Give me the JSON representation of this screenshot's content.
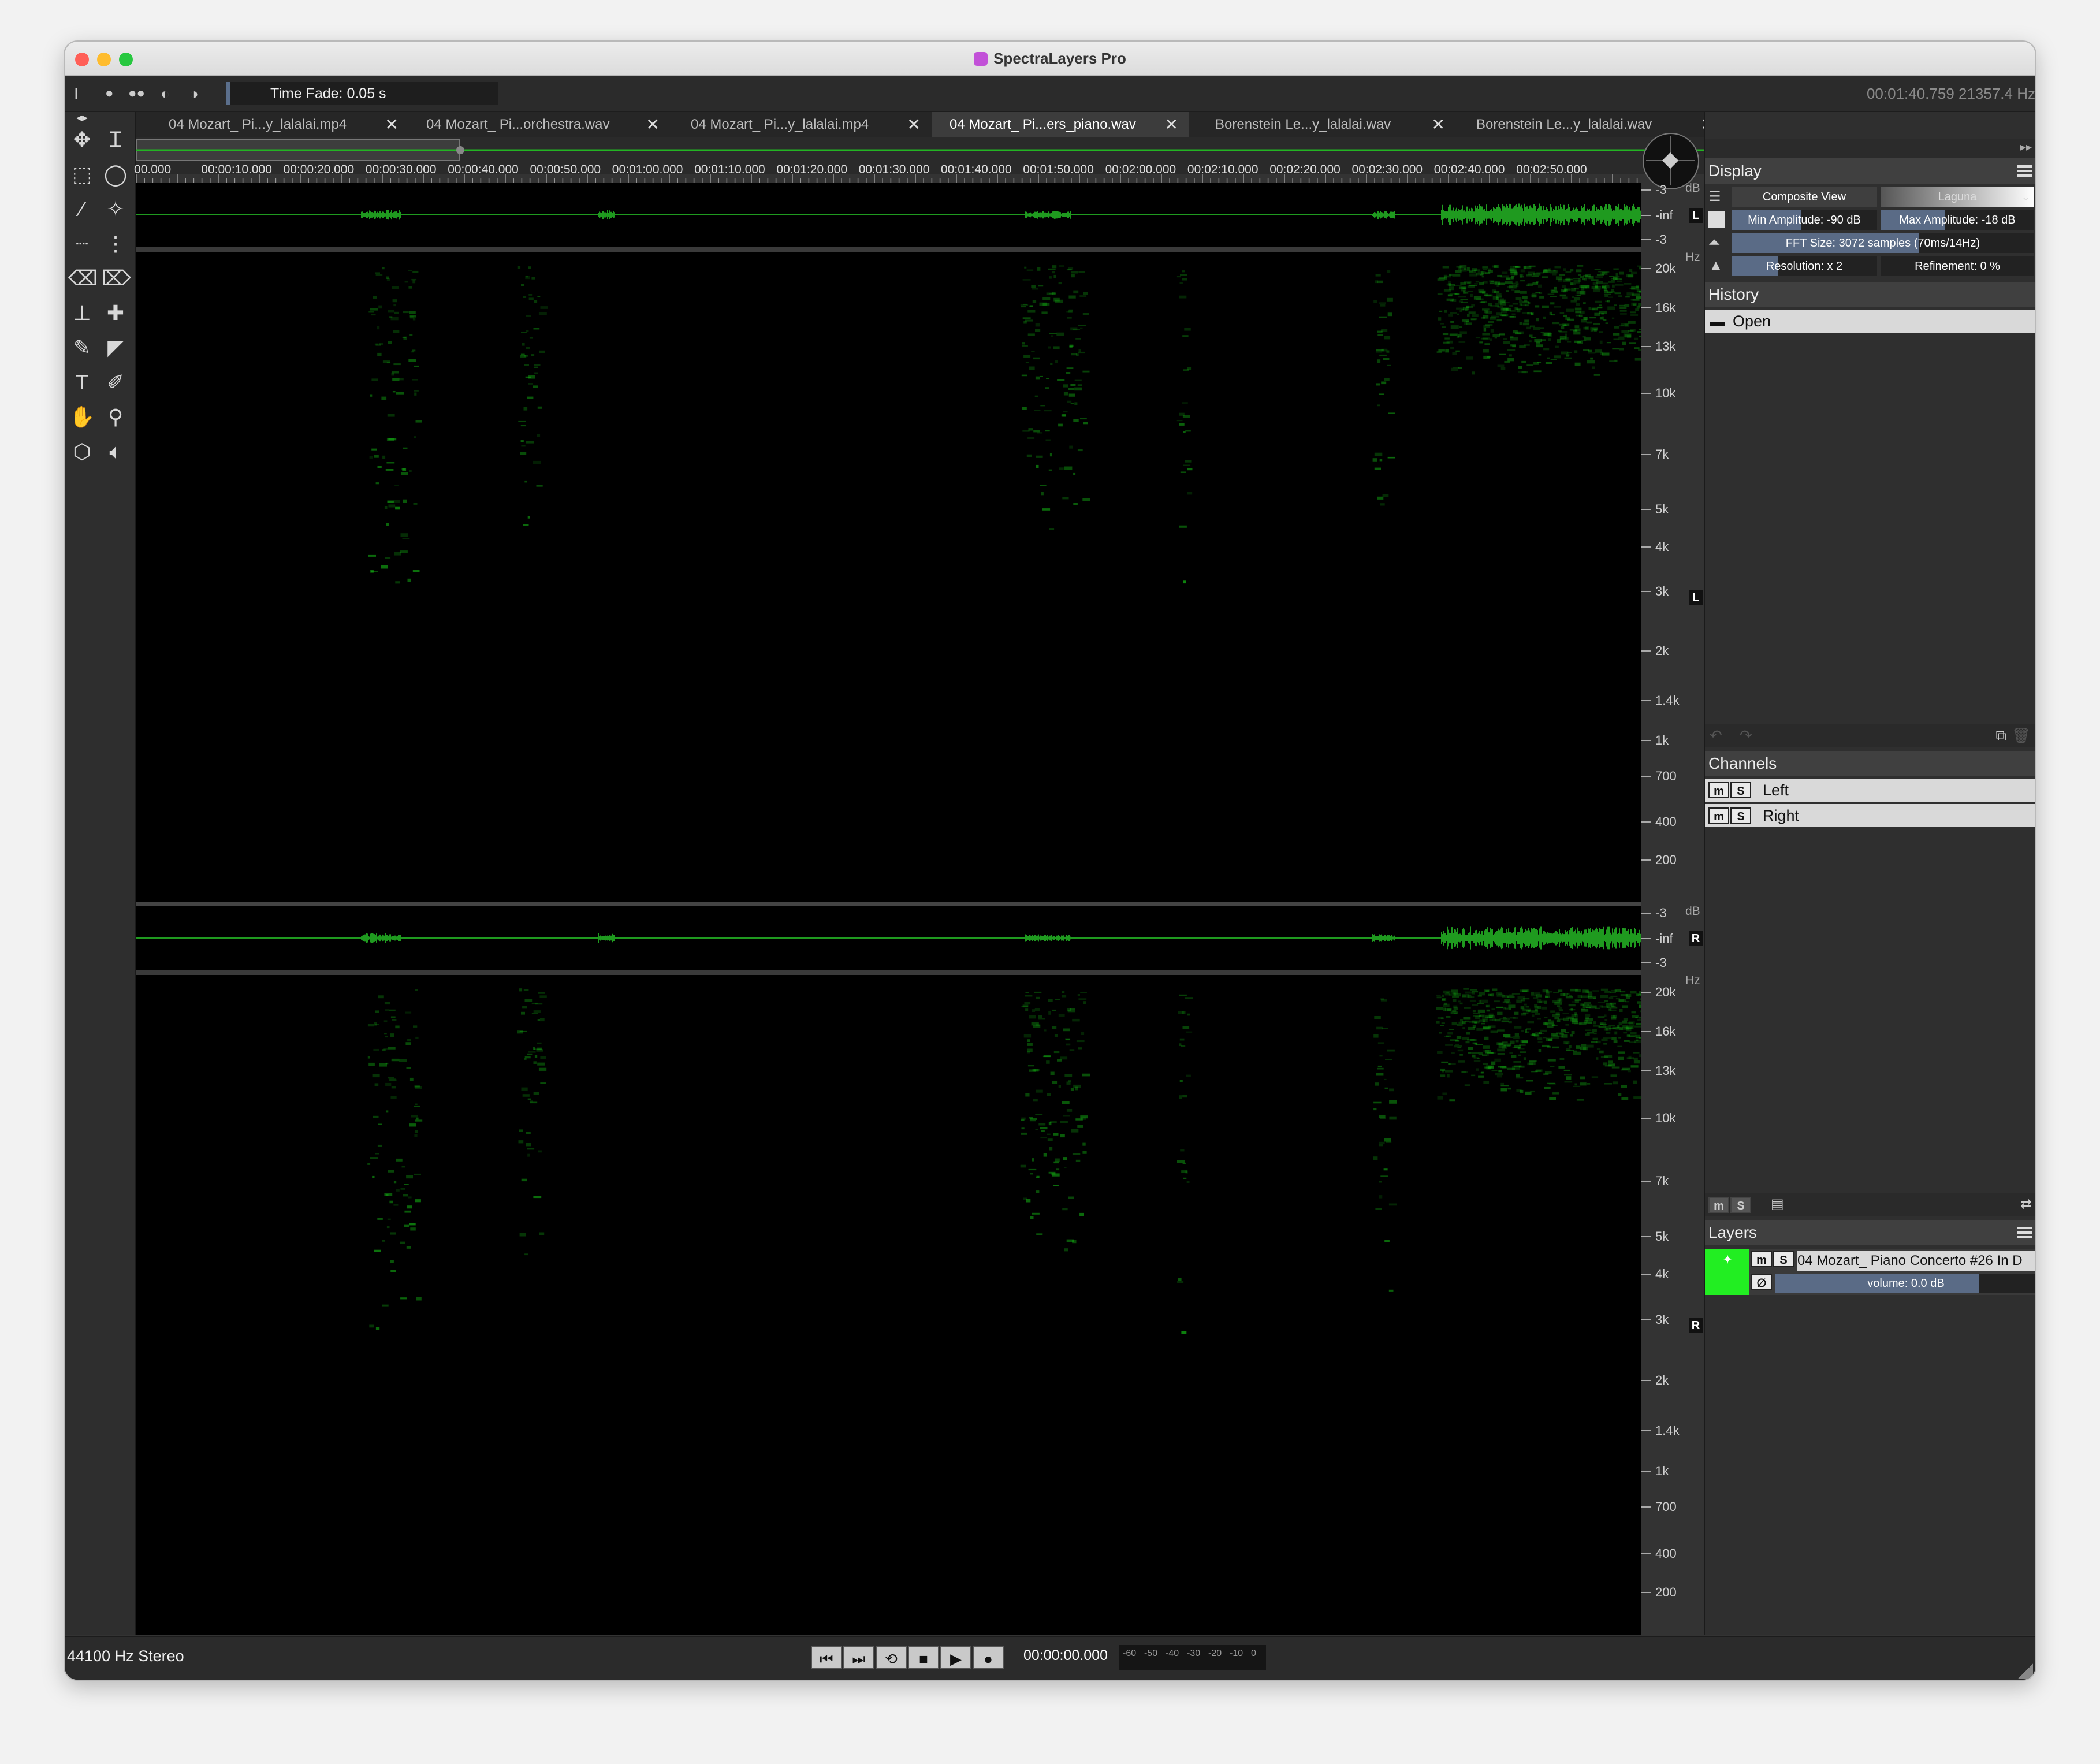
{
  "window": {
    "title": "SpectraLayers Pro",
    "traffic_lights": {
      "close": "#ff5f57",
      "minimize": "#febc2e",
      "maximize": "#28c840"
    }
  },
  "toolbar": {
    "time_fade_label": "Time Fade: 0.05 s",
    "cursor_readout": "00:01:40.759  21357.4 Hz"
  },
  "tabs": [
    {
      "label": "04 Mozart_ Pi...y_lalalai.mp4"
    },
    {
      "label": "04 Mozart_ Pi...orchestra.wav"
    },
    {
      "label": "04 Mozart_ Pi...y_lalalai.mp4"
    },
    {
      "label": "04 Mozart_ Pi...ers_piano.wav"
    },
    {
      "label": "Borenstein Le...y_lalalai.wav"
    },
    {
      "label": "Borenstein Le...y_lalalai.wav"
    }
  ],
  "active_tab": 3,
  "close_glyph": "✕",
  "ruler": {
    "labels": [
      "00.000",
      "00:00:10.000",
      "00:00:20.000",
      "00:00:30.000",
      "00:00:40.000",
      "00:00:50.000",
      "00:01:00.000",
      "00:01:10.000",
      "00:01:20.000",
      "00:01:30.000",
      "00:01:40.000",
      "00:01:50.000",
      "00:02:00.000",
      "00:02:10.000",
      "00:02:20.000",
      "00:02:30.000",
      "00:02:40.000",
      "00:02:50.000"
    ]
  },
  "channels_view": {
    "db_unit": "dB",
    "hz_unit": "Hz",
    "db_ticks": [
      "-3",
      "-inf",
      "-3"
    ],
    "hz_ticks": [
      "20k",
      "16k",
      "13k",
      "10k",
      "7k",
      "5k",
      "4k",
      "3k",
      "2k",
      "1.4k",
      "1k",
      "700",
      "400",
      "200"
    ],
    "left_tag": "L",
    "right_tag": "R",
    "spectrogram_color": "#16c916",
    "waveform_color": "#1f9a1f"
  },
  "display_panel": {
    "title": "Display",
    "composite_label": "Composite View",
    "palette_label": "Laguna",
    "min_amplitude": "Min Amplitude: -90 dB",
    "max_amplitude": "Max Amplitude: -18 dB",
    "fft_size": "FFT Size: 3072 samples (70ms/14Hz)",
    "resolution": "Resolution: x 2",
    "refinement": "Refinement: 0 %",
    "min_amplitude_fill": 0.48,
    "max_amplitude_fill": 0.42,
    "fft_fill": 0.62,
    "resolution_fill": 0.32
  },
  "history_panel": {
    "title": "History",
    "items": [
      {
        "label": "Open"
      }
    ]
  },
  "channels_panel": {
    "title": "Channels",
    "items": [
      {
        "label": "Left"
      },
      {
        "label": "Right"
      }
    ],
    "mute_label": "m",
    "solo_label": "S"
  },
  "layers_panel": {
    "title": "Layers",
    "layer_name": "04 Mozart_ Piano Concerto #26 In D",
    "volume": "volume: 0.0 dB",
    "volume_fill": 0.78,
    "thumb_color": "#22ee22"
  },
  "status": {
    "format": "44100 Hz Stereo",
    "timecode": "00:00:00.000",
    "meter_labels": [
      "-60",
      "-50",
      "-40",
      "-30",
      "-20",
      "-10",
      "0"
    ]
  },
  "transport": [
    "skip-back",
    "skip-forward",
    "loop",
    "stop",
    "play",
    "record"
  ]
}
